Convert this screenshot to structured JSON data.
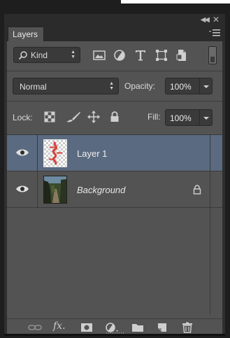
{
  "panel": {
    "tab_label": "Layers",
    "icons": {
      "collapse": "double-chevron-left-icon",
      "close": "close-icon",
      "menu": "panel-menu-icon"
    }
  },
  "filter": {
    "kind_label": "Kind",
    "icons": [
      "pixel-filter-icon",
      "adjustment-filter-icon",
      "type-filter-icon",
      "shape-filter-icon",
      "smart-object-filter-icon"
    ]
  },
  "blend": {
    "mode": "Normal",
    "opacity_label": "Opacity:",
    "opacity_value": "100%"
  },
  "lock": {
    "label": "Lock:",
    "fill_label": "Fill:",
    "fill_value": "100%",
    "icons": [
      "lock-transparent-pixels-icon",
      "lock-image-pixels-icon",
      "lock-position-icon",
      "lock-all-icon"
    ]
  },
  "layers": [
    {
      "name": "Layer 1",
      "selected": true,
      "visible": true
    },
    {
      "name": "Background",
      "selected": false,
      "visible": true,
      "locked": true
    }
  ],
  "bottom_icons": [
    "link-layers-icon",
    "fx-icon",
    "add-mask-icon",
    "adjustment-layer-icon",
    "new-group-icon",
    "new-layer-icon",
    "delete-layer-icon"
  ],
  "colors": {
    "panel_bg": "#535353",
    "selected_row": "#5a6a80"
  }
}
